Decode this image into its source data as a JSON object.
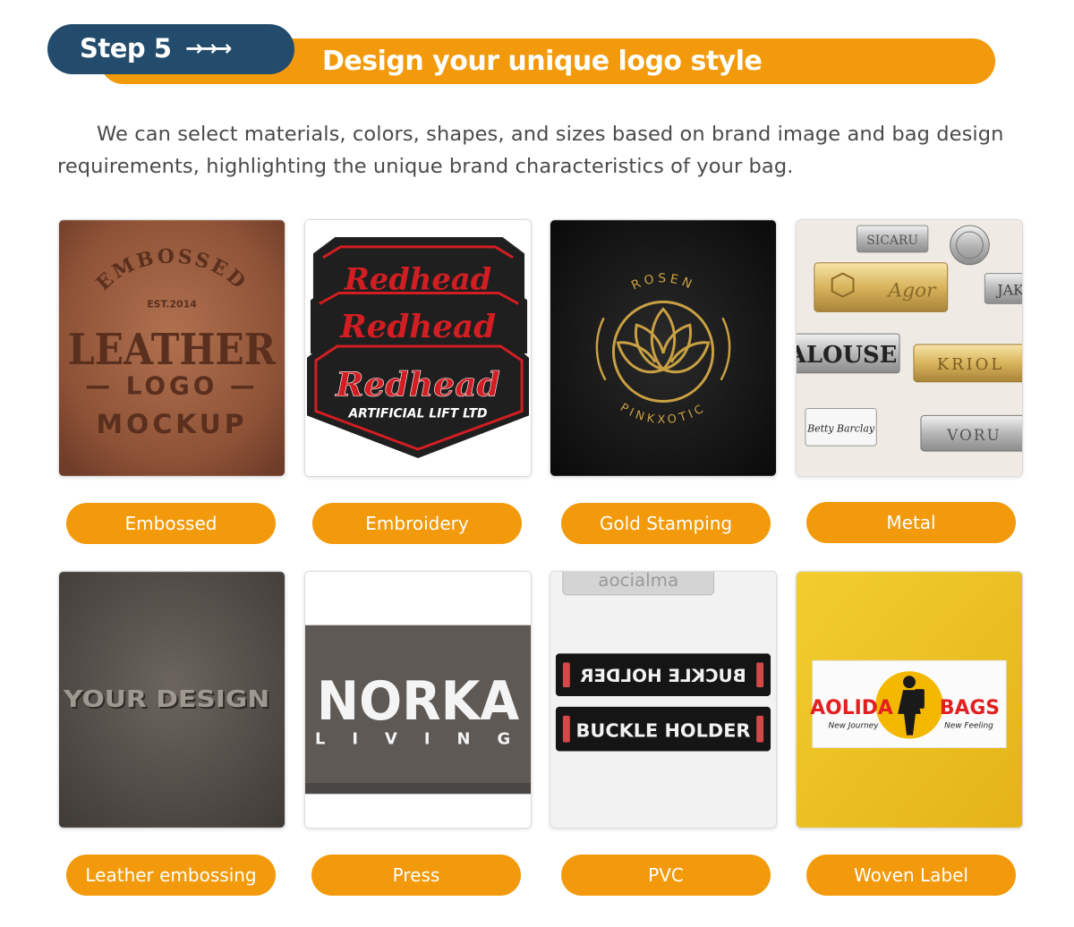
{
  "header": {
    "step_label": "Step 5",
    "arrows": "→→→",
    "title": "Design your unique logo style"
  },
  "intro": "We can select materials, colors, shapes, and sizes based on brand image and bag design requirements, highlighting the unique brand characteristics of your bag.",
  "colors": {
    "accent": "#F29A0B",
    "step_badge": "#234B6B"
  },
  "cards": [
    {
      "label": "Embossed",
      "photo": {
        "arc_text": "EMBOSSED",
        "line1": "EST.2014",
        "line2": "LEATHER",
        "line3": "— LOGO —",
        "line4": "MOCKUP"
      }
    },
    {
      "label": "Embroidery",
      "photo": {
        "brand": "Redhead",
        "sub": "ARTIFICIAL LIFT LTD"
      }
    },
    {
      "label": "Gold Stamping",
      "photo": {
        "top": "ROSEN",
        "bottom": "PINKXOTIC"
      }
    },
    {
      "label": "Metal",
      "photo": {
        "t1": "SICARU",
        "t2": "Agor",
        "t3": "ALOUSE",
        "t4": "KRIOL",
        "t5": "Betty Barclay",
        "t6": "VORU",
        "t7": "JAK"
      }
    },
    {
      "label": "Leather embossing",
      "photo": {
        "text": "YOUR DESIGN"
      }
    },
    {
      "label": "Press",
      "photo": {
        "brand": "NORKA",
        "sub": "L I V I N G"
      }
    },
    {
      "label": "PVC",
      "photo": {
        "top": "aocialma",
        "mirror": "BUCKLE HOLDER",
        "main": "BUCKLE HOLDER"
      }
    },
    {
      "label": "Woven Label",
      "photo": {
        "left": "AOLIDA",
        "right": "BAGS",
        "sub1": "New Journey",
        "sub2": "New Feeling"
      }
    }
  ]
}
